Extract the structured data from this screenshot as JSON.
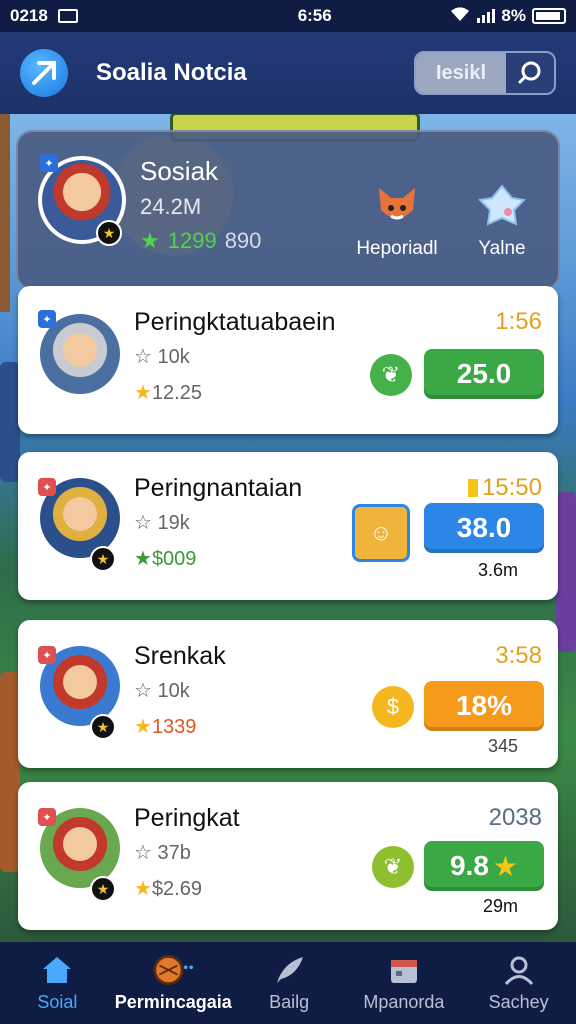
{
  "status_bar": {
    "left_text": "0218",
    "time": "6:56",
    "battery": "8%"
  },
  "header": {
    "title": "Soalia Notcia",
    "search_placeholder": "Iesikl"
  },
  "profile": {
    "name": "Sosiak",
    "followers": "24.2M",
    "stat_green": "1299",
    "stat_gray": "890",
    "mini_items": [
      {
        "label": "Heporiadl",
        "icon": "fox-icon"
      },
      {
        "label": "Yalne",
        "icon": "crystal-icon"
      }
    ]
  },
  "cards": [
    {
      "title": "Peringktatuabaein",
      "likes": "10k",
      "points": "12.25",
      "time": "1:56",
      "time_color": "#e0a21f",
      "score": "25.0",
      "score_color": "#3aa845",
      "sub": "",
      "badge_icon": "leaf-icon",
      "badge_color": "#46b04a",
      "points_color": "#666666",
      "tag_color": "#2a6fdc"
    },
    {
      "title": "Peringnantaian",
      "likes": "19k",
      "points": "$009",
      "time": "15:50",
      "time_color": "#e0a21f",
      "score": "38.0",
      "score_color": "#2c86e6",
      "sub": "3.6m",
      "badge_icon": "character-icon",
      "badge_color": "#f0b43a",
      "points_color": "#3a9a3a",
      "tag_color": "#e05050"
    },
    {
      "title": "Srenkak",
      "likes": "10k",
      "points": "1339",
      "time": "3:58",
      "time_color": "#e0a21f",
      "score": "18%",
      "score_color": "#f59a1a",
      "sub": "345",
      "badge_icon": "coin-icon",
      "badge_color": "#f5b71f",
      "points_color": "#e0552a",
      "tag_color": "#e05050"
    },
    {
      "title": "Peringkat",
      "likes": "37b",
      "points": "$2.69",
      "time": "2038",
      "time_color": "#5a6b88",
      "score": "9.8",
      "score_color": "#3aa845",
      "sub": "29m",
      "badge_icon": "leaf-icon",
      "badge_color": "#8fbf2f",
      "points_color": "#666666",
      "tag_color": "#e05050"
    }
  ],
  "nav": [
    {
      "label": "Soial",
      "icon": "home-icon"
    },
    {
      "label": "Permincagaia",
      "icon": "soccer-ball-icon"
    },
    {
      "label": "Bailg",
      "icon": "feather-icon"
    },
    {
      "label": "Mpanorda",
      "icon": "calendar-icon"
    },
    {
      "label": "Sachey",
      "icon": "profile-icon"
    }
  ]
}
